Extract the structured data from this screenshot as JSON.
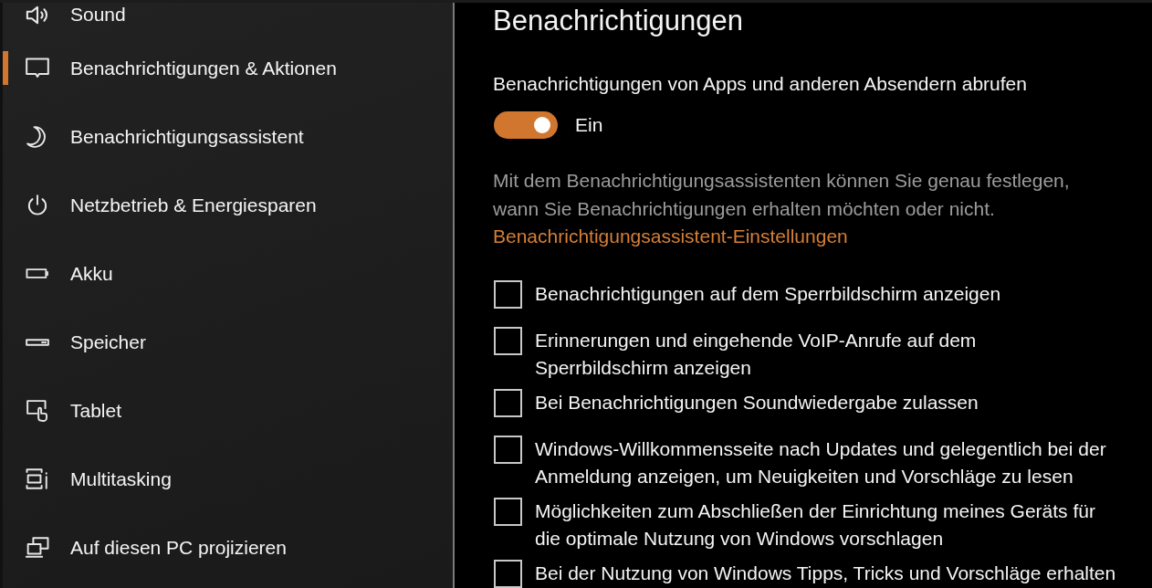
{
  "sidebar": {
    "items": [
      {
        "label": "Sound",
        "selected": false
      },
      {
        "label": "Benachrichtigungen & Aktionen",
        "selected": true
      },
      {
        "label": "Benachrichtigungsassistent",
        "selected": false
      },
      {
        "label": "Netzbetrieb & Energiesparen",
        "selected": false
      },
      {
        "label": "Akku",
        "selected": false
      },
      {
        "label": "Speicher",
        "selected": false
      },
      {
        "label": "Tablet",
        "selected": false
      },
      {
        "label": "Multitasking",
        "selected": false
      },
      {
        "label": "Auf diesen PC projizieren",
        "selected": false
      }
    ]
  },
  "content": {
    "title": "Benachrichtigungen",
    "setting": {
      "label": "Benachrichtigungen von Apps und anderen Absendern abrufen",
      "on": true,
      "state_label": "Ein"
    },
    "description": "Mit dem Benachrichtigungsassistenten können Sie genau festlegen,\nwann Sie Benachrichtigungen erhalten möchten oder nicht.",
    "link": "Benachrichtigungsassistent-Einstellungen",
    "checkboxes": [
      {
        "label": "Benachrichtigungen auf dem Sperrbildschirm anzeigen",
        "checked": false
      },
      {
        "label": "Erinnerungen und eingehende VoIP-Anrufe auf dem\nSperrbildschirm anzeigen",
        "checked": false
      },
      {
        "label": "Bei Benachrichtigungen Soundwiedergabe zulassen",
        "checked": false
      },
      {
        "label": "Windows-Willkommensseite nach Updates und gelegentlich bei der\nAnmeldung anzeigen, um Neuigkeiten und Vorschläge zu lesen",
        "checked": false
      },
      {
        "label": "Möglichkeiten zum Abschließen der Einrichtung meines Geräts für\ndie optimale Nutzung von Windows vorschlagen",
        "checked": false
      },
      {
        "label": "Bei der Nutzung von Windows Tipps, Tricks und Vorschläge erhalten",
        "checked": false
      }
    ]
  }
}
